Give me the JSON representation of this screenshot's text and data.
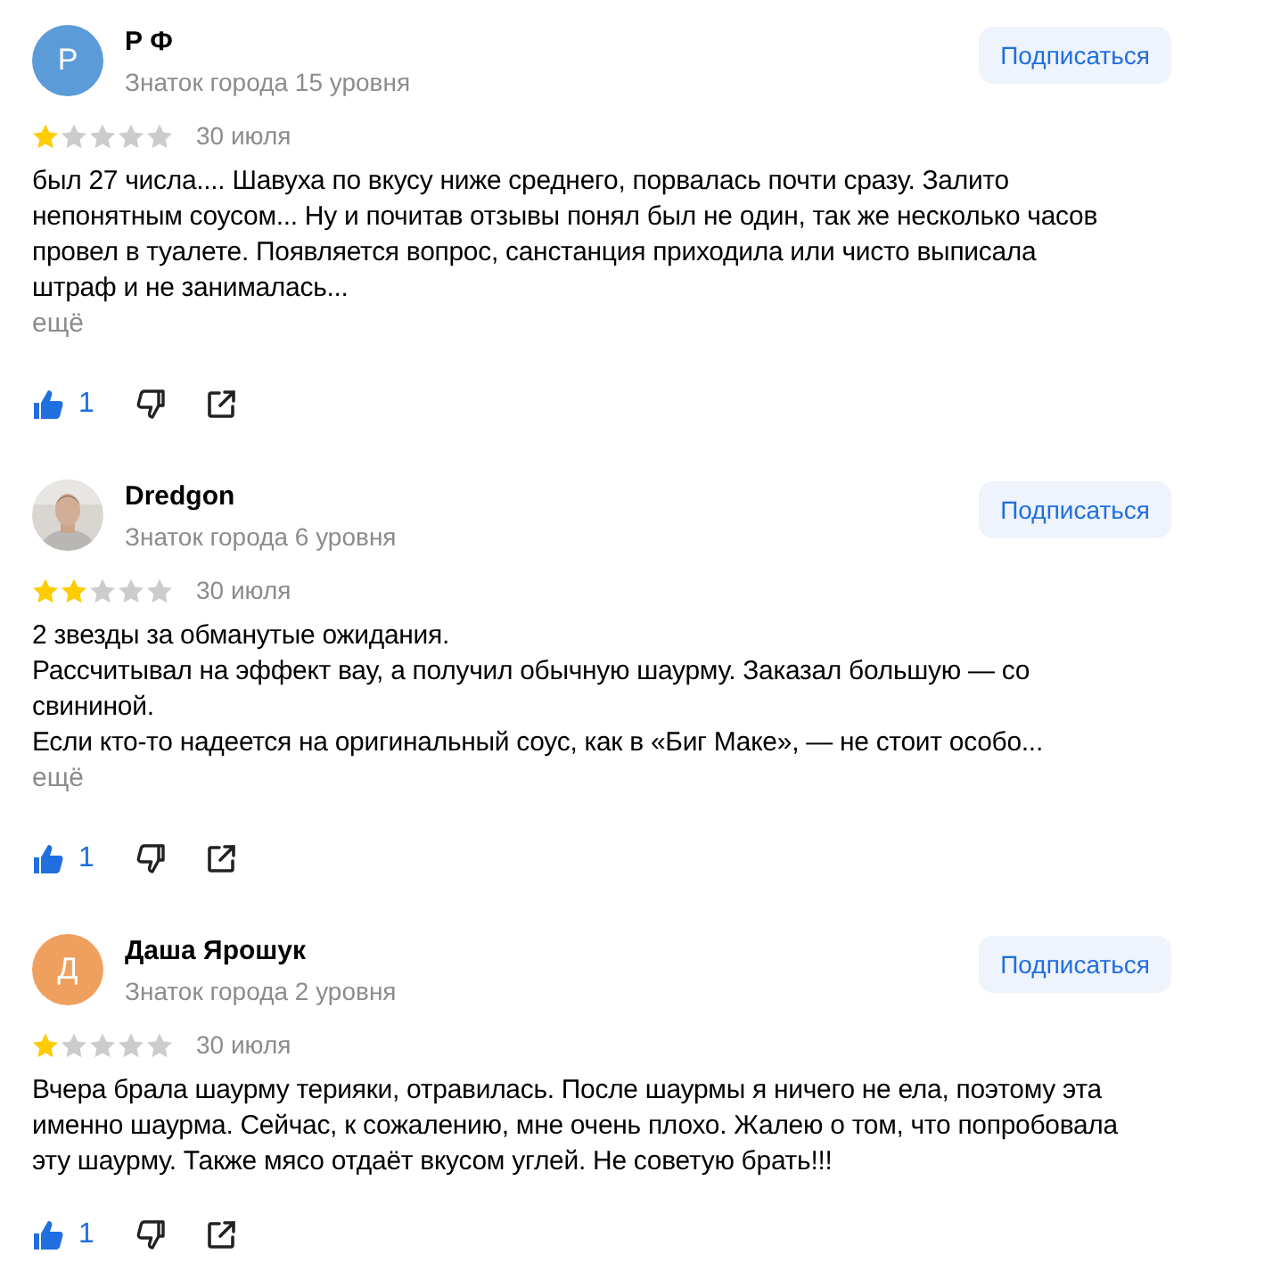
{
  "reviews": [
    {
      "author": {
        "name": "Р Ф",
        "level": "Знаток города 15 уровня",
        "avatar": {
          "kind": "letter",
          "letter": "Р",
          "color": "#5b9bd8"
        }
      },
      "subscribe": "Подписаться",
      "stars": 1,
      "date": "30 июля",
      "paragraphs": [
        "был 27 числа.... Шавуха по вкусу ниже среднего, порвалась почти сразу. Залито непонятным соусом... Ну и почитав отзывы понял был не один, так же несколько часов провел в туалете. Появляется вопрос, санстанция приходила или чисто выписала штраф и не занималась..."
      ],
      "more": "ещё",
      "likes": "1"
    },
    {
      "author": {
        "name": "Dredgon",
        "level": "Знаток города 6 уровня"
      },
      "subscribe": "Подписаться",
      "stars": 2,
      "date": "30 июля",
      "paragraphs": [
        "2 звезды за обманутые ожидания.",
        "Рассчитывал на эффект вау, а получил обычную шаурму. Заказал большую — со свининой.",
        "Если кто-то надеется на оригинальный соус, как в «Биг Маке», — не стоит особо..."
      ],
      "more": "ещё",
      "likes": "1"
    },
    {
      "author": {
        "name": "Даша Ярошук",
        "level": "Знаток города 2 уровня",
        "avatar": {
          "kind": "letter",
          "letter": "Д",
          "color": "#f0a05e"
        }
      },
      "subscribe": "Подписаться",
      "stars": 1,
      "date": "30 июля",
      "paragraphs": [
        "Вчера брала шаурму терияки, отравилась. После шаурмы я ничего не ела, поэтому эта именно шаурма. Сейчас, к сожалению, мне очень плохо. Жалею о том, что попробовала эту шаурму. Также мясо отдаёт вкусом углей. Не советую брать!!!"
      ],
      "likes": "1"
    }
  ]
}
